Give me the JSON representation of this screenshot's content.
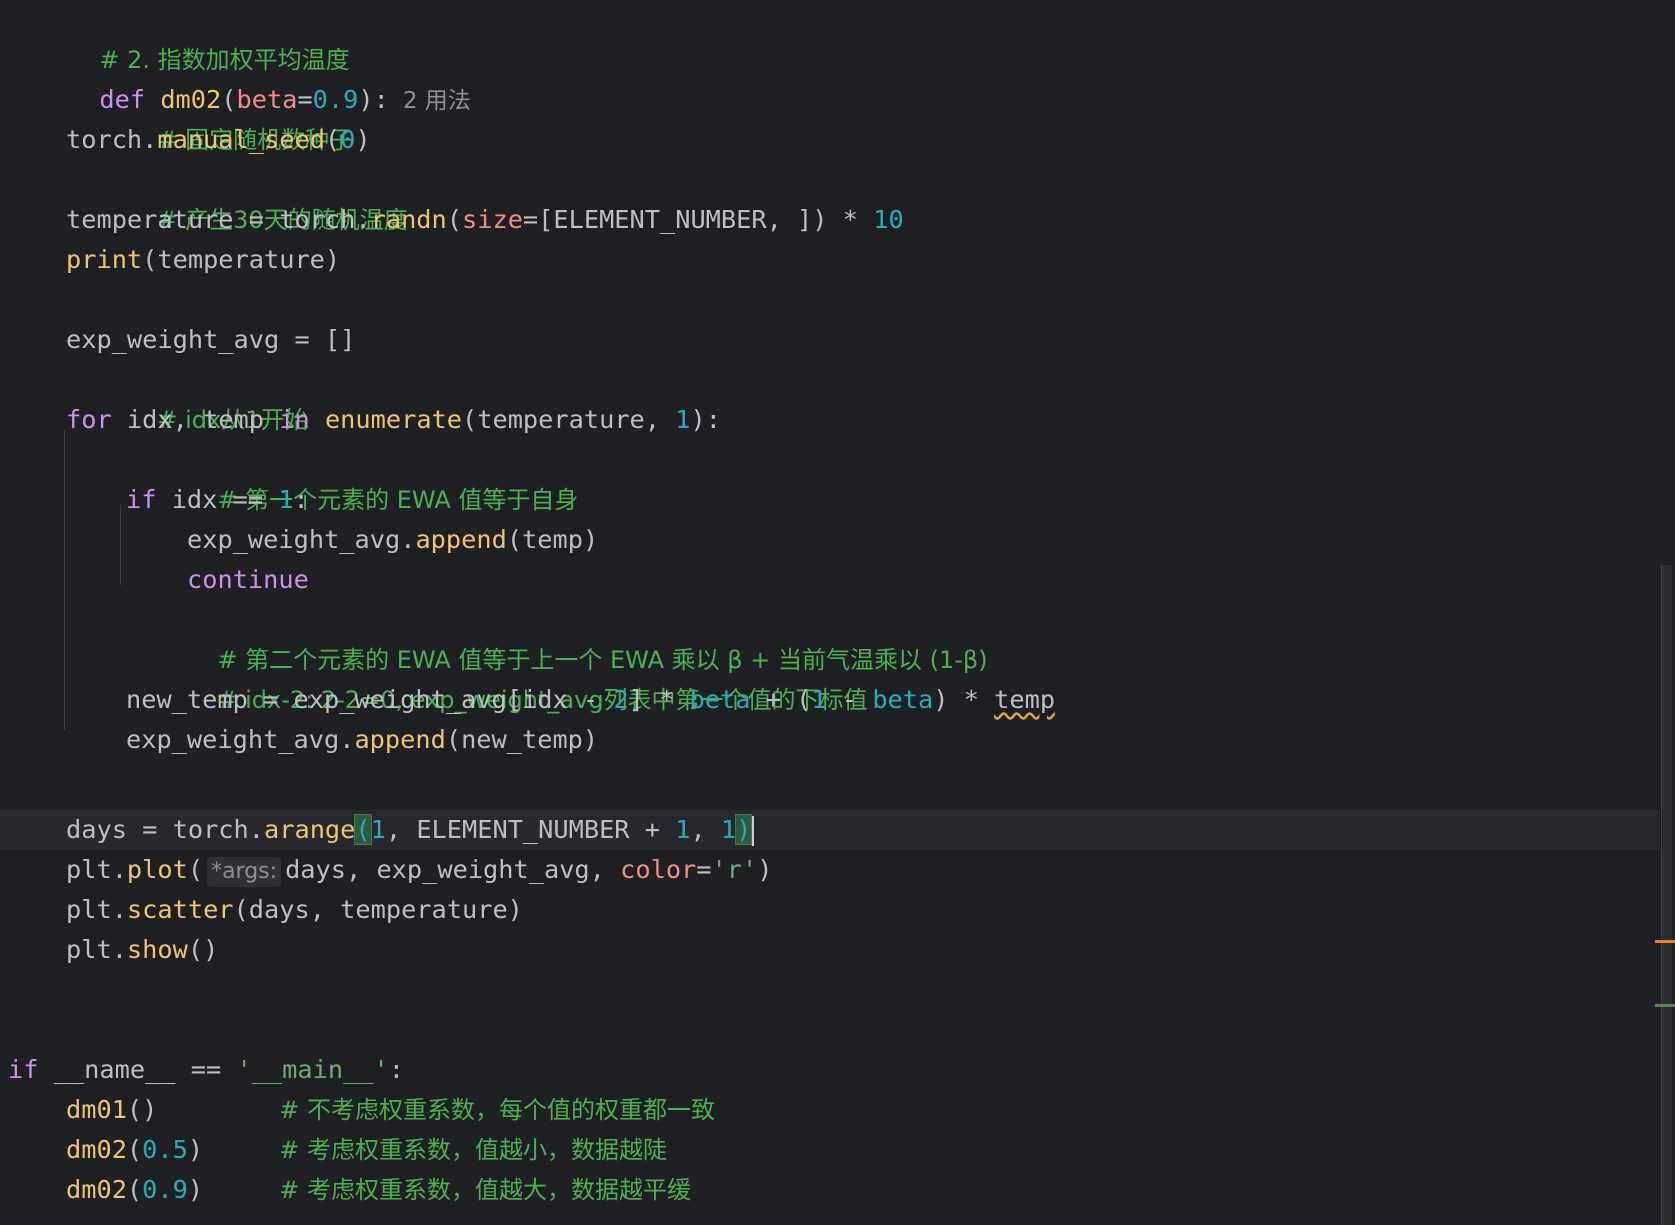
{
  "editor": {
    "colors": {
      "background": "#1e1f22",
      "keyword": "#cf8ee8",
      "function": "#eec371",
      "number": "#2aacb8",
      "comment": "#4caf50",
      "parameter": "#f28b82",
      "text": "#bcbec4",
      "warning_marker": "#e3861f",
      "ok_marker": "#4e8a4f"
    },
    "lines": {
      "l1": {
        "comment": "# 2. 指数加权平均温度"
      },
      "l2": {
        "kw": "def",
        "name": "dm02",
        "p1": "(",
        "param": "beta",
        "eq": "=",
        "num": "0.9",
        "p2": "):",
        "usage": "2 用法"
      },
      "l3": {
        "comment": "# 固定随机数种子"
      },
      "l4": {
        "a": "torch.",
        "fn": "manual_seed",
        "b": "(",
        "num": "0",
        "c": ")"
      },
      "l5": {
        "comment": "# 产生30天的随机温度"
      },
      "l6": {
        "a": "temperature = torch.",
        "fn": "randn",
        "b": "(",
        "param": "size",
        "c": "=[ELEMENT_NUMBER, ]) * ",
        "num": "10"
      },
      "l7": {
        "fn": "print",
        "b": "(temperature)"
      },
      "l8": {
        "a": "exp_weight_avg = []"
      },
      "l9": {
        "comment": "# idx从1开始"
      },
      "l10": {
        "kw1": "for",
        "a": " idx, temp ",
        "kw2": "in",
        "sp": " ",
        "fn": "enumerate",
        "b": "(temperature, ",
        "num": "1",
        "c": "):"
      },
      "l11": {
        "comment": "# 第一个元素的 EWA 值等于自身"
      },
      "l12": {
        "kw": "if",
        "a": " idx == ",
        "num": "1",
        "b": ":"
      },
      "l13": {
        "a": "exp_weight_avg.",
        "fn": "append",
        "b": "(temp)"
      },
      "l14": {
        "kw": "continue"
      },
      "l15": {
        "comment": "# 第二个元素的 EWA 值等于上一个 EWA 乘以 β + 当前气温乘以 (1-β)"
      },
      "l16": {
        "comment": "# idx-2: 2-2=0, exp_weight_avg列表中第一个值的下标值"
      },
      "l17": {
        "a": "new_temp = exp_weight_avg[idx - ",
        "num1": "2",
        "b": "] * ",
        "param1": "beta",
        "c": " + (",
        "num2": "1",
        "d": " - ",
        "param2": "beta",
        "e": ") * ",
        "f": "temp"
      },
      "l18": {
        "a": "exp_weight_avg.",
        "fn": "append",
        "b": "(new_temp)"
      },
      "l19": {
        "a": "days = torch.",
        "fn": "arange",
        "b": "(",
        "num1": "1",
        "c": ", ELEMENT_NUMBER + ",
        "num2": "1",
        "d": ", ",
        "num3": "1",
        "e": ")"
      },
      "l20": {
        "a": "plt.",
        "fn": "plot",
        "b": "(",
        "hint": "*args:",
        "c": "days, exp_weight_avg, ",
        "param": "color",
        "d": "=",
        "str": "'r'",
        "e": ")"
      },
      "l21": {
        "a": "plt.",
        "fn": "scatter",
        "b": "(days, temperature)"
      },
      "l22": {
        "a": "plt.",
        "fn": "show",
        "b": "()"
      },
      "l23": {
        "kw": "if",
        "a": " __name__ == ",
        "str": "'__main__'",
        "b": ":"
      },
      "l24": {
        "fn": "dm01",
        "a": "()",
        "gap": "        ",
        "comment": "# 不考虑权重系数，每个值的权重都一致"
      },
      "l25": {
        "fn": "dm02",
        "a": "(",
        "num": "0.5",
        "b": ")",
        "gap": "     ",
        "comment": "# 考虑权重系数，值越小，数据越陡"
      },
      "l26": {
        "fn": "dm02",
        "a": "(",
        "num": "0.9",
        "b": ")",
        "gap": "     ",
        "comment": "# 考虑权重系数，值越大，数据越平缓"
      }
    }
  }
}
